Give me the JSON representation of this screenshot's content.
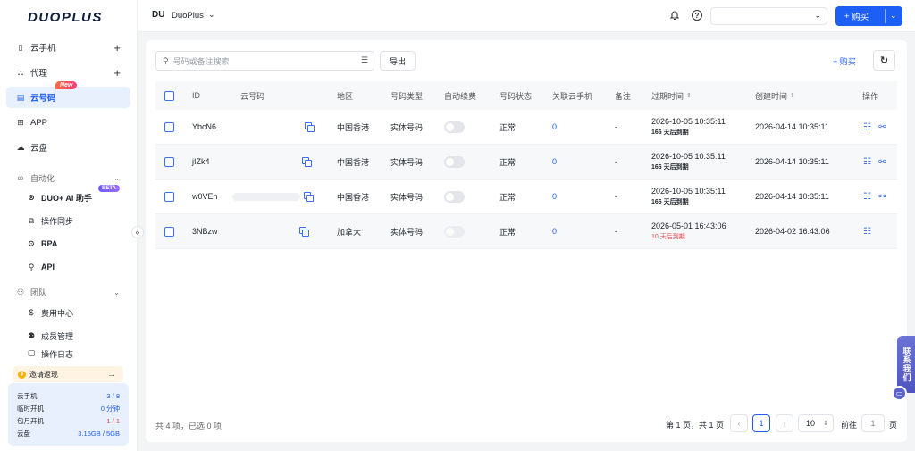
{
  "app": {
    "logo": "DUOPLUS"
  },
  "sidebar": {
    "items": [
      {
        "label": "云手机",
        "icon": "phone-icon"
      },
      {
        "label": "代理",
        "icon": "network-icon"
      },
      {
        "label": "云号码",
        "icon": "sim-icon",
        "badge": "New"
      },
      {
        "label": "APP",
        "icon": "apps-icon"
      },
      {
        "label": "云盘",
        "icon": "cloud-icon"
      }
    ],
    "automation": {
      "label": "自动化",
      "items": [
        {
          "label": "DUO+ AI 助手",
          "badge": "BETA",
          "icon": "ai-icon"
        },
        {
          "label": "操作同步",
          "icon": "sync-icon"
        },
        {
          "label": "RPA",
          "icon": "robot-icon"
        },
        {
          "label": "API",
          "icon": "api-icon"
        }
      ]
    },
    "team": {
      "label": "团队",
      "items": [
        {
          "label": "费用中心",
          "icon": "dollar-icon"
        },
        {
          "label": "成员管理",
          "icon": "members-icon"
        },
        {
          "label": "操作日志",
          "icon": "log-icon"
        }
      ]
    },
    "invite": {
      "label": "邀请返现"
    },
    "quota": [
      {
        "label": "云手机",
        "value": "3 / 8"
      },
      {
        "label": "临时开机",
        "value": "0 分钟"
      },
      {
        "label": "包月开机",
        "value": "1 / 1"
      },
      {
        "label": "云盘",
        "value": "3.15GB / 5GB"
      }
    ]
  },
  "header": {
    "workspace_badge": "DU",
    "workspace_name": "DuoPlus",
    "buy_label": "购买"
  },
  "toolbar": {
    "search_placeholder": "号码或备注搜索",
    "export_label": "导出",
    "buy_label": "购买"
  },
  "table": {
    "columns": [
      "ID",
      "云号码",
      "地区",
      "号码类型",
      "自动续费",
      "号码状态",
      "关联云手机",
      "备注",
      "过期时间",
      "创建时间",
      "操作"
    ],
    "rows": [
      {
        "id": "YbcN6",
        "region": "中国香港",
        "type": "实体号码",
        "status": "正常",
        "linked": "0",
        "note": "-",
        "expire": "2026-10-05 10:35:11",
        "expire_days": "166 天后到期",
        "created": "2026-04-14 10:35:11"
      },
      {
        "id": "jIZk4",
        "region": "中国香港",
        "type": "实体号码",
        "status": "正常",
        "linked": "0",
        "note": "-",
        "expire": "2026-10-05 10:35:11",
        "expire_days": "166 天后到期",
        "created": "2026-04-14 10:35:11"
      },
      {
        "id": "w0VEn",
        "region": "中国香港",
        "type": "实体号码",
        "status": "正常",
        "linked": "0",
        "note": "-",
        "expire": "2026-10-05 10:35:11",
        "expire_days": "166 天后到期",
        "created": "2026-04-14 10:35:11"
      },
      {
        "id": "3NBzw",
        "region": "加拿大",
        "type": "实体号码",
        "status": "正常",
        "linked": "0",
        "note": "-",
        "expire": "2026-05-01 16:43:06",
        "expire_days": "10 天后到期",
        "created": "2026-04-02 16:43:06"
      }
    ]
  },
  "footer": {
    "total": "共 4 项，已选 0 项",
    "page_info": "第 1 页，共 1 页",
    "current_page": "1",
    "page_size": "10",
    "goto_label": "前往",
    "goto_value": "1",
    "goto_unit": "页"
  },
  "contact": {
    "label": "联系我们"
  },
  "colors": {
    "accent": "#1d5ff5",
    "warn": "#e5484d"
  }
}
